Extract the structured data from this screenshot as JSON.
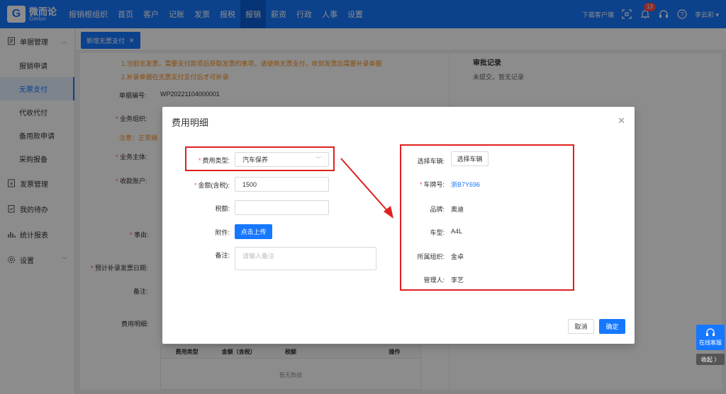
{
  "brand": {
    "cn": "微而论",
    "en": "Gerlun"
  },
  "nav": [
    {
      "label": "报销根组织"
    },
    {
      "label": "首页"
    },
    {
      "label": "客户"
    },
    {
      "label": "记账"
    },
    {
      "label": "发票"
    },
    {
      "label": "报税"
    },
    {
      "label": "报销"
    },
    {
      "label": "薪资"
    },
    {
      "label": "行政"
    },
    {
      "label": "人事"
    },
    {
      "label": "设置"
    }
  ],
  "topbar": {
    "download": "下载客户端",
    "notif_count": "13",
    "user": "李云彩"
  },
  "sidebar": {
    "doc_group": "单据管理",
    "items": [
      {
        "label": "报销申请"
      },
      {
        "label": "无票支付"
      },
      {
        "label": "代收代付"
      },
      {
        "label": "备用款申请"
      },
      {
        "label": "采购报备"
      }
    ],
    "invoice_group": "发票管理",
    "todo_group": "我的待办",
    "report_group": "统计报表",
    "settings_group": "设置"
  },
  "tab": {
    "label": "新增无票支付"
  },
  "bg_form": {
    "notice1": "1.当前无发票，需要支付款项后获取发票的事项，请使用无票支付，收到发票后需要补录单据",
    "notice2": "2.补录单据在无票支付支付后才可补录",
    "doc_no_label": "单据编号:",
    "doc_no": "WP20221104000001",
    "org_label": "业务组织:",
    "warn": "注意：正常捐",
    "subject_label": "业务主体:",
    "account_label": "收款账户:",
    "reason_label": "事由:",
    "date_label": "预计补录发票日期:",
    "remark_label": "备注:",
    "fee_label": "费用明细:",
    "audit_title": "审批记录",
    "audit_text": "未提交，暂无记录",
    "table_headers": [
      "费用类型",
      "金额（含税）",
      "税额",
      "",
      "操作"
    ],
    "table_empty": "暂无数据"
  },
  "modal": {
    "title": "费用明细",
    "fee_type_label": "费用类型:",
    "fee_type_value": "汽车保养",
    "amount_label": "金额(含税):",
    "amount_value": "1500",
    "tax_label": "税额:",
    "tax_value": "",
    "attach_label": "附件:",
    "upload_btn": "点击上传",
    "remark_label": "备注:",
    "remark_placeholder": "请输入备注",
    "vehicle_label": "选择车辆:",
    "vehicle_btn": "选择车辆",
    "plate_label": "车牌号:",
    "plate_value": "浙B7Y696",
    "brand_label": "品牌:",
    "brand_value": "奥迪",
    "model_label": "车型:",
    "model_value": "A4L",
    "org_label": "所属组织:",
    "org_value": "金卓",
    "manager_label": "管理人:",
    "manager_value": "李艺",
    "cancel_btn": "取消",
    "ok_btn": "确定"
  },
  "float": {
    "service": "在线客服",
    "fold": "收起 〉"
  },
  "colors": {
    "primary": "#1677ff",
    "highlight": "#e02020",
    "warning": "#fa8c16"
  }
}
